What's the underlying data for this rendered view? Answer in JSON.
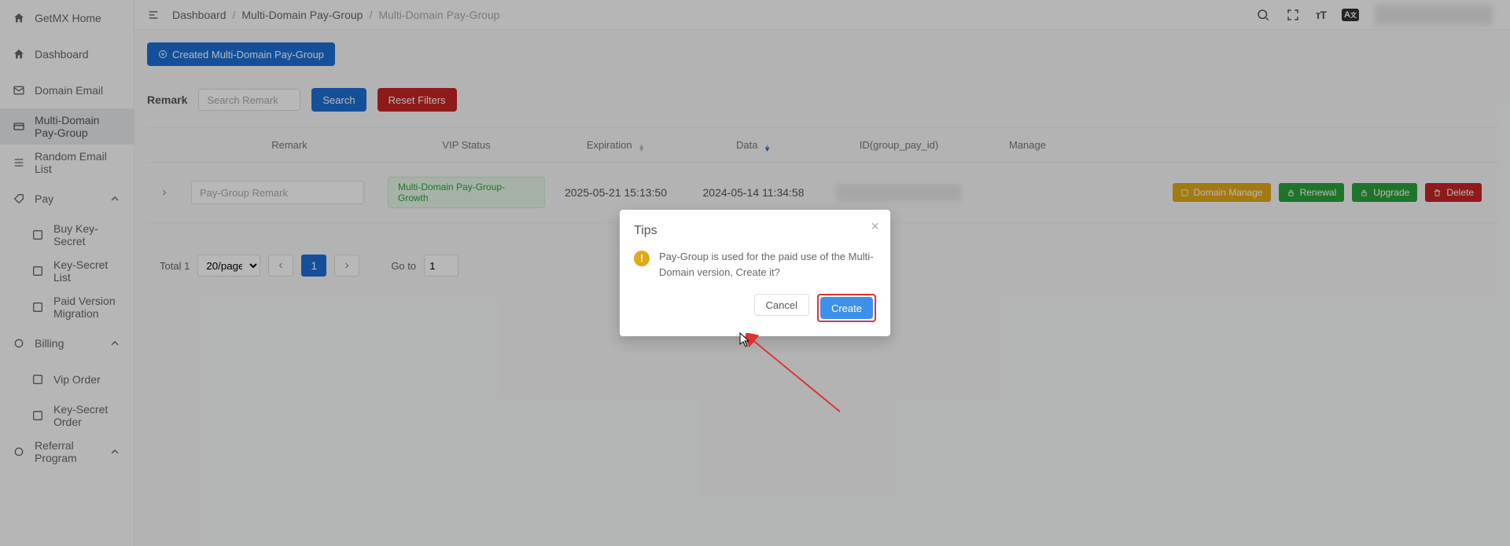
{
  "sidebar": {
    "items": [
      {
        "label": "GetMX Home",
        "icon": "home"
      },
      {
        "label": "Dashboard",
        "icon": "home"
      },
      {
        "label": "Domain Email",
        "icon": "mail"
      },
      {
        "label": "Multi-Domain Pay-Group",
        "icon": "card",
        "active": true
      },
      {
        "label": "Random Email List",
        "icon": "list"
      },
      {
        "label": "Pay",
        "icon": "tag",
        "chevron": true
      },
      {
        "label": "Buy Key-Secret",
        "sub": true
      },
      {
        "label": "Key-Secret List",
        "sub": true
      },
      {
        "label": "Paid Version Migration",
        "sub": true
      },
      {
        "label": "Billing",
        "icon": "gear",
        "chevron": true
      },
      {
        "label": "Vip Order",
        "sub": true
      },
      {
        "label": "Key-Secret Order",
        "sub": true
      },
      {
        "label": "Referral Program",
        "icon": "gear",
        "chevron": true
      }
    ]
  },
  "breadcrumb": {
    "b0": "Dashboard",
    "b1": "Multi-Domain Pay-Group",
    "b2": "Multi-Domain Pay-Group"
  },
  "actions": {
    "create_group": "Created Multi-Domain Pay-Group",
    "search": "Search",
    "reset": "Reset Filters"
  },
  "filters": {
    "remark_label": "Remark",
    "remark_placeholder": "Search Remark"
  },
  "table": {
    "headers": {
      "remark": "Remark",
      "vip": "VIP Status",
      "exp": "Expiration",
      "data": "Data",
      "id": "ID(group_pay_id)",
      "manage": "Manage"
    },
    "rows": [
      {
        "remark_placeholder": "Pay-Group Remark",
        "vip": "Multi-Domain Pay-Group-Growth",
        "exp": "2025-05-21 15:13:50",
        "data": "2024-05-14 11:34:58",
        "id": "",
        "buttons": {
          "domain_manage": "Domain Manage",
          "renewal": "Renewal",
          "upgrade": "Upgrade",
          "delete": "Delete"
        }
      }
    ]
  },
  "pagination": {
    "total": "Total 1",
    "per_page": "20/page",
    "current": "1",
    "goto_label": "Go to",
    "goto_value": "1"
  },
  "dialog": {
    "title": "Tips",
    "message": "Pay-Group is used for the paid use of the Multi-Domain version, Create it?",
    "cancel": "Cancel",
    "create": "Create"
  }
}
